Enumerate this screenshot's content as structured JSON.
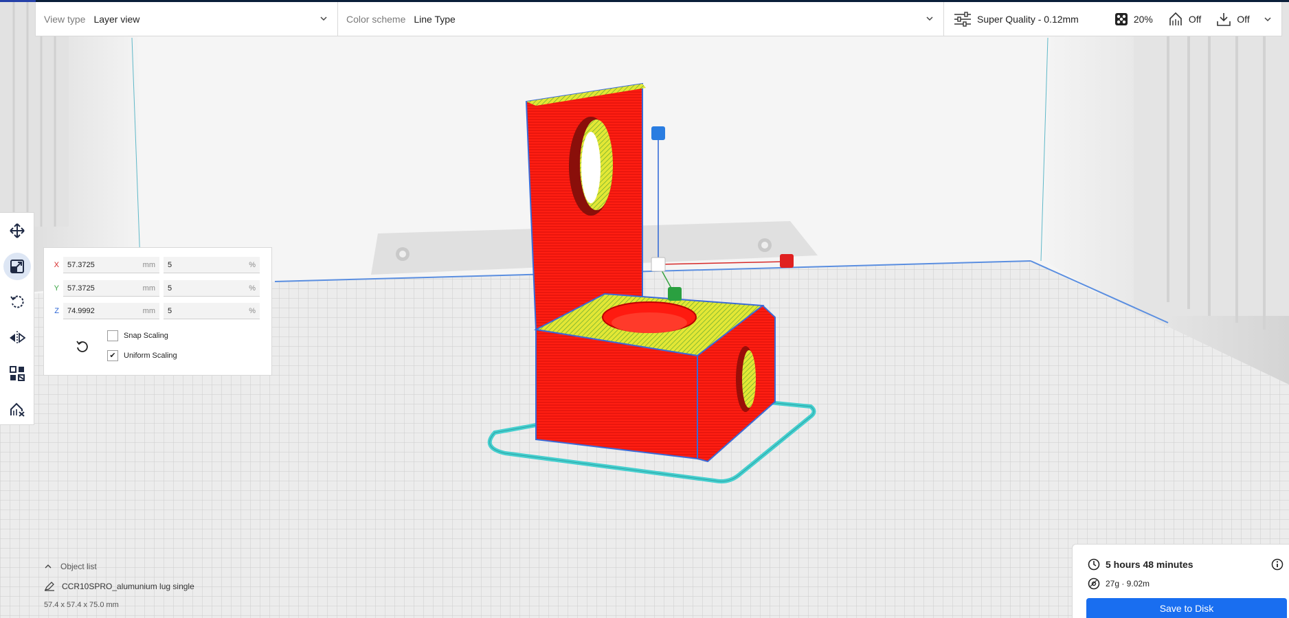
{
  "header": {
    "view_type": {
      "label": "View type",
      "value": "Layer view"
    },
    "color_scheme": {
      "label": "Color scheme",
      "value": "Line Type"
    },
    "print_settings": {
      "profile": "Super Quality - 0.12mm",
      "infill": "20%",
      "support": "Off",
      "adhesion": "Off"
    }
  },
  "toolbar": {
    "tools": [
      {
        "name": "move",
        "icon": "move-icon",
        "active": false
      },
      {
        "name": "scale",
        "icon": "scale-icon",
        "active": true
      },
      {
        "name": "rotate",
        "icon": "rotate-icon",
        "active": false
      },
      {
        "name": "mirror",
        "icon": "mirror-icon",
        "active": false
      },
      {
        "name": "per-model-settings",
        "icon": "per-model-settings-icon",
        "active": false
      },
      {
        "name": "support-blocker",
        "icon": "support-blocker-icon",
        "active": false
      }
    ]
  },
  "scale_panel": {
    "rows": [
      {
        "axis": "X",
        "mm": "57.3725",
        "mm_unit": "mm",
        "percent": "5",
        "percent_unit": "%"
      },
      {
        "axis": "Y",
        "mm": "57.3725",
        "mm_unit": "mm",
        "percent": "5",
        "percent_unit": "%"
      },
      {
        "axis": "Z",
        "mm": "74.9992",
        "mm_unit": "mm",
        "percent": "5",
        "percent_unit": "%"
      }
    ],
    "snap_scaling": {
      "label": "Snap Scaling",
      "checked": false
    },
    "uniform_scaling": {
      "label": "Uniform Scaling",
      "checked": true,
      "mark": "✔"
    }
  },
  "object_list": {
    "title": "Object list",
    "item_name": "CCR10SPRO_alumunium lug single",
    "dimensions": "57.4 x 57.4 x 75.0 mm"
  },
  "summary": {
    "print_time": "5 hours 48 minutes",
    "material": "27g · 9.02m",
    "save_label": "Save to Disk"
  },
  "colors": {
    "accent": "#196ef0",
    "model_wall": "#ff1a10",
    "model_top": "#e8ec3a",
    "skirt": "#4fd6d6",
    "axis_x": "#d62828",
    "axis_y": "#36a340",
    "axis_z": "#2a64d6"
  }
}
